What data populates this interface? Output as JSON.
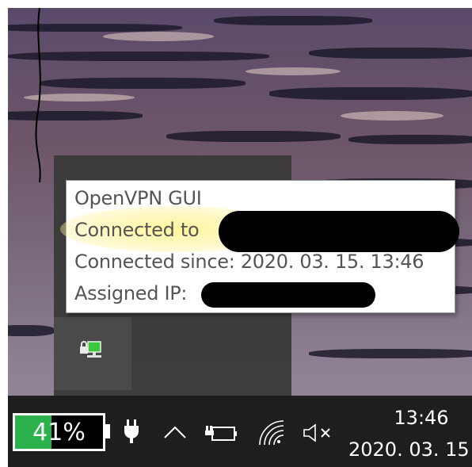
{
  "tooltip": {
    "title": "OpenVPN GUI",
    "connected_to_label": "Connected to",
    "connected_since": "Connected since: 2020. 03. 15. 13:46",
    "assigned_ip_label": "Assigned IP:"
  },
  "taskbar": {
    "battery_percent_text": "41%",
    "battery_level": 0.41,
    "clock_time": "13:46",
    "clock_date": "2020. 03. 15"
  },
  "icons": {
    "tray_app": "openvpn-connected-icon",
    "power": "power-plug-icon",
    "overflow": "chevron-up-icon",
    "battery_small": "battery-icon",
    "wifi": "wifi-icon",
    "volume": "volume-muted-icon"
  },
  "colors": {
    "battery_fill": "#2bb24c",
    "highlight": "#fff59a",
    "vpn_icon": "#3cc83c"
  }
}
